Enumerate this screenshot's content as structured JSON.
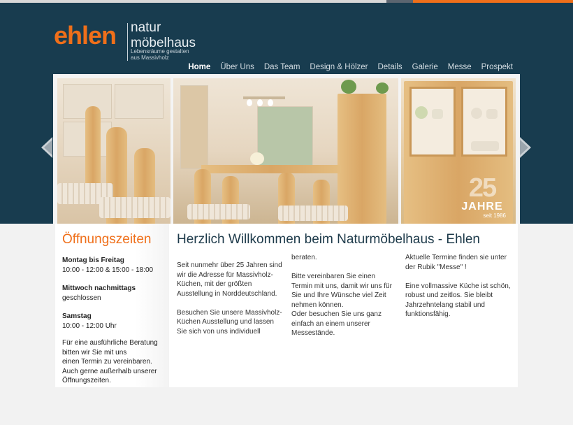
{
  "brand": {
    "name": "ehlen",
    "sub": "naturmöbelhaus",
    "sub1": "natur",
    "sub2": "möbelhaus",
    "tagline1": "Lebensräume gestalten",
    "tagline2": "aus Massivholz",
    "accent": "#ef6f1a",
    "header_bg": "#183c4f"
  },
  "nav": {
    "items": [
      {
        "label": "Home",
        "active": true
      },
      {
        "label": "Über Uns"
      },
      {
        "label": "Das Team"
      },
      {
        "label": "Design & Hölzer"
      },
      {
        "label": "Details"
      },
      {
        "label": "Galerie"
      },
      {
        "label": "Messe"
      },
      {
        "label": "Prospekt"
      }
    ]
  },
  "slider": {
    "badge_number": "25",
    "badge_word": "JAHRE",
    "badge_since": "seit 1986",
    "prev_icon": "arrow-left-icon",
    "next_icon": "arrow-right-icon"
  },
  "hours": {
    "title": "Öffnungszeiten",
    "blocks": [
      {
        "day": "Montag bis Freitag",
        "time": "10:00 - 12:00 & 15:00 - 18:00"
      },
      {
        "day": "Mittwoch nachmittags",
        "time": "geschlossen"
      },
      {
        "day": "Samstag",
        "time": "10:00 - 12:00 Uhr"
      }
    ],
    "note_lines": [
      "Für eine ausführliche Beratung",
      "bitten wir Sie mit uns",
      "einen Termin zu vereinbaren.",
      "Auch gerne außerhalb unserer",
      "Öffnungszeiten."
    ]
  },
  "welcome": {
    "title": "Herzlich Willkommen beim Naturmöbelhaus - Ehlen",
    "col1": [
      "Seit nunmehr über 25 Jahren sind wir die Adresse für Massivholz-Küchen, mit der größten Ausstellung in Norddeutschland.",
      "Besuchen Sie unsere Massivholz-Küchen Ausstellung und lassen Sie sich von uns individuell"
    ],
    "col2": [
      "beraten.",
      "Bitte vereinbaren Sie einen Termin mit uns, damit wir uns für Sie und Ihre Wünsche viel Zeit nehmen können.",
      "Oder besuchen Sie uns ganz einfach an einem unserer Messestände."
    ],
    "col3": [
      "Aktuelle Termine finden sie unter der Rubik \"Messe\" !",
      "Eine vollmassive Küche ist schön, robust und zeitlos. Sie bleibt Jahrzehntelang stabil und funktionsfähig."
    ]
  }
}
